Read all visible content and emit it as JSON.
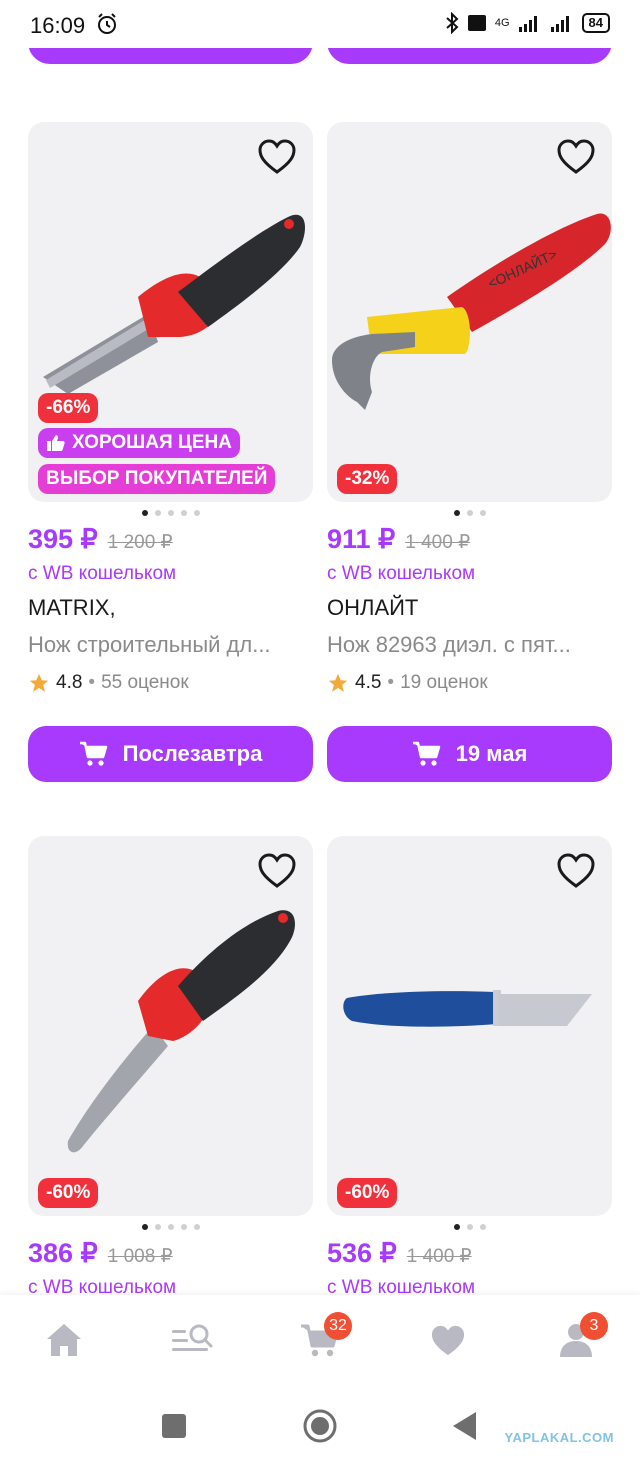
{
  "status_bar": {
    "time": "16:09",
    "network": "4G",
    "battery": "84"
  },
  "products": [
    {
      "price": "395 ₽",
      "old_price": "1 200 ₽",
      "wallet": "с WB кошельком",
      "brand": "MATRIX,",
      "name": "Нож строительный дл...",
      "rating": "4.8",
      "reviews": "55 оценок",
      "discount": "-66%",
      "badge_good": "ХОРОШАЯ ЦЕНА",
      "badge_choice": "ВЫБОР ПОКУПАТЕЛЕЙ",
      "delivery": "Послезавтра",
      "image_icon": "knife-red-black-icon",
      "dots": 5
    },
    {
      "price": "911 ₽",
      "old_price": "1 400 ₽",
      "wallet": "с WB кошельком",
      "brand": "ОНЛАЙТ",
      "name": "Нож 82963 диэл. с пят...",
      "rating": "4.5",
      "reviews": "19 оценок",
      "discount": "-32%",
      "delivery": "19 мая",
      "image_icon": "knife-yellow-red-hook-icon",
      "dots": 3
    },
    {
      "price": "386 ₽",
      "old_price": "1 008 ₽",
      "wallet": "с WB кошельком",
      "discount": "-60%",
      "image_icon": "knife-red-black-curved-icon",
      "dots": 5
    },
    {
      "price": "536 ₽",
      "old_price": "1 400 ₽",
      "wallet": "с WB кошельком",
      "discount": "-60%",
      "image_icon": "knife-blue-icon",
      "dots": 3
    }
  ],
  "bottom_nav": {
    "cart_count": "32",
    "profile_count": "3"
  },
  "watermark": "YAPLAKAL.COM",
  "colors": {
    "accent": "#a73afd",
    "discount": "#f0313c",
    "badge_good": "#c93ff0",
    "badge_choice": "#e43ed7",
    "nav_icon": "#b9b9c3",
    "nav_badge": "#f04f33"
  }
}
